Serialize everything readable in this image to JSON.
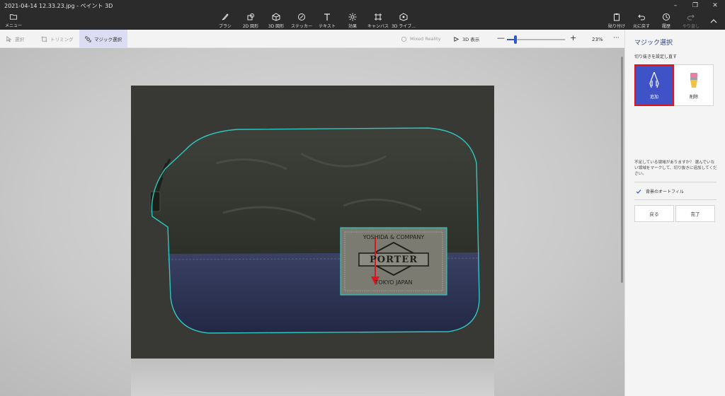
{
  "window": {
    "title": "2021-04-14 12.33.23.jpg - ペイント 3D",
    "controls": [
      "minimize",
      "maximize",
      "close"
    ]
  },
  "toolbar": {
    "menu_label": "メニュー",
    "tools": [
      {
        "label": "ブラシ",
        "icon": "brush-icon"
      },
      {
        "label": "2D 図形",
        "icon": "2d-shapes-icon"
      },
      {
        "label": "3D 図形",
        "icon": "3d-shapes-icon"
      },
      {
        "label": "ステッカー",
        "icon": "sticker-icon"
      },
      {
        "label": "テキスト",
        "icon": "text-icon"
      },
      {
        "label": "効果",
        "icon": "effects-icon"
      },
      {
        "label": "キャンバス",
        "icon": "canvas-icon"
      },
      {
        "label": "3D ライブ...",
        "icon": "3d-library-icon"
      }
    ],
    "right_tools": [
      {
        "label": "貼り付け",
        "icon": "paste-icon",
        "enabled": true
      },
      {
        "label": "元に戻す",
        "icon": "undo-icon",
        "enabled": true
      },
      {
        "label": "履歴",
        "icon": "history-icon",
        "enabled": true
      },
      {
        "label": "やり直し",
        "icon": "redo-icon",
        "enabled": false
      }
    ]
  },
  "subbar": {
    "select_label": "選択",
    "crop_label": "トリミング",
    "magic_select_label": "マジック選択",
    "mixed_reality_label": "Mixed Reality",
    "view3d_label": "3D 表示",
    "zoom_minus": "—",
    "zoom_plus": "+",
    "zoom_value": "23%",
    "zoom_level": 0.15,
    "more": "···"
  },
  "photo": {
    "tag_line1": "YOSHIDA & COMPANY",
    "tag_brand": "PORTER",
    "tag_line2": "TOKYO  JAPAN"
  },
  "panel": {
    "title": "マジック選択",
    "subtitle": "切り抜きを設定し直す",
    "add_label": "追加",
    "remove_label": "削除",
    "hint": "不足している領域がありますか？ 選んでいない領域をマークして、切り抜きに追加してください。",
    "autofill_label": "背景のオートフィル",
    "back_label": "戻る",
    "done_label": "完了"
  },
  "colors": {
    "accent": "#3f53c7",
    "highlight_box": "#e0141c",
    "selection_outline": "#2ec7c0",
    "arrow": "#e0141c"
  }
}
